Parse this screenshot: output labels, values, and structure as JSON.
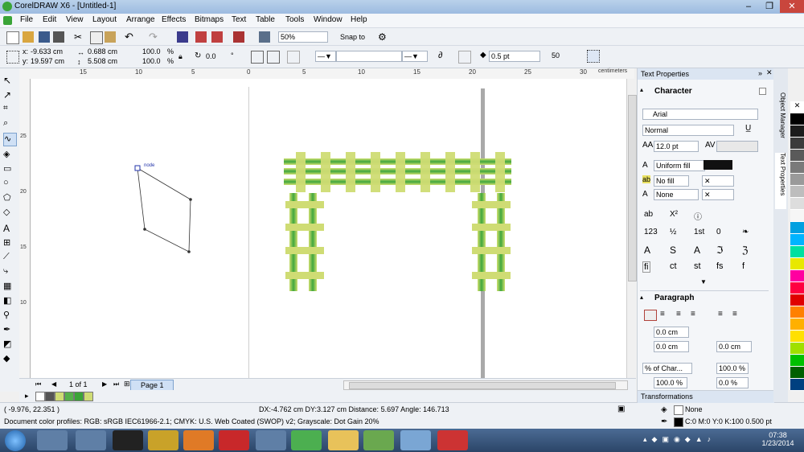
{
  "window": {
    "title": "CorelDRAW X6 - [Untitled-1]"
  },
  "menu": [
    "File",
    "Edit",
    "View",
    "Layout",
    "Arrange",
    "Effects",
    "Bitmaps",
    "Text",
    "Table",
    "Tools",
    "Window",
    "Help"
  ],
  "standard": {
    "zoom": "50%",
    "snap": "Snap to"
  },
  "property_bar": {
    "x": "-9.633 cm",
    "y": "19.597 cm",
    "w": "0.688 cm",
    "h": "5.508 cm",
    "scale_w": "100.0",
    "scale_h": "100.0",
    "pct1": "%",
    "pct2": "%",
    "angle": "0.0",
    "deg": "°",
    "outline": "0.5 pt",
    "smooth": "50"
  },
  "rulers": {
    "top_ticks": [
      "15",
      "10",
      "5",
      "0",
      "5",
      "10",
      "15",
      "20",
      "25",
      "30",
      "35"
    ],
    "left_ticks": [
      "25",
      "20",
      "15",
      "10"
    ],
    "units": "centimeters"
  },
  "canvas": {
    "node_label": "node"
  },
  "doc_nav": {
    "page_count": "1 of 1",
    "page_tab": "Page 1"
  },
  "status": {
    "coords": "( -9.976, 22.351 )",
    "measure": "DX:-4.762 cm DY:3.127 cm Distance: 5.697 Angle: 146.713",
    "profiles": "Document color profiles: RGB: sRGB IEC61966-2.1; CMYK: U.S. Web Coated (SWOP) v2; Grayscale: Dot Gain 20%",
    "fill": "None",
    "outline": "C:0 M:0 Y:0 K:100  0.500 pt"
  },
  "docker": {
    "title": "Text Properties",
    "character_section": "Character",
    "font": "Arial",
    "style": "Normal",
    "size": "12.0 pt",
    "fill_type": "Uniform fill",
    "bg_fill": "No fill",
    "outline": "None",
    "paragraph_section": "Paragraph",
    "para_field1": "0.0 cm",
    "para_field2": "0.0 cm",
    "para_field3": "0.0 cm",
    "char_pct": "% of Char...",
    "para_field4": "100.0 %",
    "para_field5": "100.0 %",
    "para_field6": "0.0 %",
    "transformations": "Transformations",
    "tab_object_manager": "Object Manager",
    "tab_text_properties": "Text Properties"
  },
  "taskbar": {
    "time": "07:38",
    "date": "1/23/2014"
  },
  "colors": {
    "bar_light": "#cfdc74",
    "bar_green": "#56b04a",
    "accent": "#3a6ea5"
  }
}
